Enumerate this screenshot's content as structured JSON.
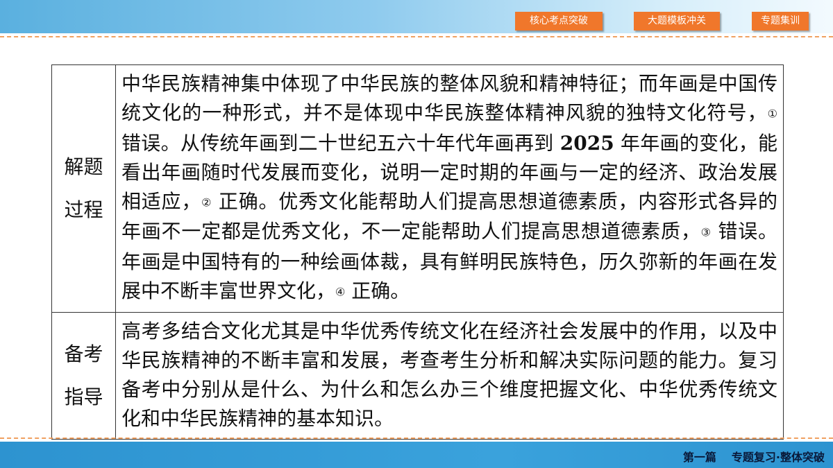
{
  "nav": {
    "btn1": "核心考点突破",
    "btn2": "大题模板冲关",
    "btn3": "专题集训"
  },
  "table": {
    "row1": {
      "label_line1": "解题",
      "label_line2": "过程",
      "t1": "中华民族精神集中体现了中华民族的整体风貌和精神特征；而年画是中国传统文化的一种形式，并不是体现中华民族整体精神风貌的独特文化符号，",
      "m1": "①",
      "t2": " 错误。从传统年画到二十世纪五六十年代年画再到 ",
      "year": "2025",
      "t3": " 年年画的变化，能看出年画随时代发展而变化，说明一定时期的年画与一定的经济、政治发展相适应，",
      "m2": "②",
      "t4": " 正确。优秀文化能帮助人们提高思想道德素质，内容形式各异的年画不一定都是优秀文化，不一定能帮助人们提高思想道德素质，",
      "m3": "③",
      "t5": " 错误。年画是中国特有的一种绘画体裁，具有鲜明民族特色，历久弥新的年画在发展中不断丰富世界文化，",
      "m4": "④",
      "t6": " 正确。"
    },
    "row2": {
      "label_line1": "备考",
      "label_line2": "指导",
      "text": "高考多结合文化尤其是中华优秀传统文化在经济社会发展中的作用，以及中华民族精神的不断丰富和发展，考查考生分析和解决实际问题的能力。复习备考中分别从是什么、为什么和怎么办三个维度把握文化、中华优秀传统文化和中华民族精神的基本知识。"
    }
  },
  "footer": {
    "part": "第一篇",
    "title": "专题复习·整体突破"
  },
  "colors": {
    "nav_button": "#f0772b",
    "top_band": "#5ab0df",
    "bottom_band": "#2d93d0",
    "dash": "#f0a060"
  }
}
